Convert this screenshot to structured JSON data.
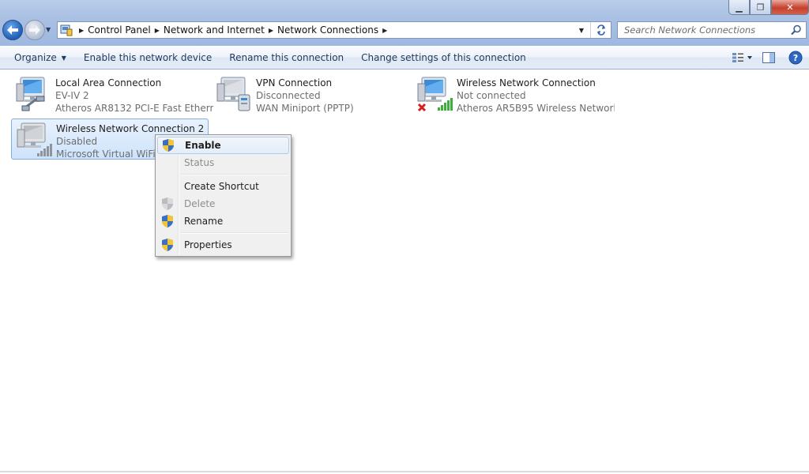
{
  "window": {
    "minimize_label": "▁",
    "maximize_label": "❐",
    "close_label": "✕"
  },
  "address": {
    "crumbs": [
      "Control Panel",
      "Network and Internet",
      "Network Connections"
    ]
  },
  "search": {
    "placeholder": "Search Network Connections"
  },
  "commands": {
    "organize": "Organize",
    "enable": "Enable this network device",
    "rename": "Rename this connection",
    "change": "Change settings of this connection"
  },
  "connections": [
    {
      "name": "Local Area Connection",
      "status": "EV-IV  2",
      "device": "Atheros AR8132 PCI-E Fast Ethern...",
      "icon": "ethernet-adapter-icon"
    },
    {
      "name": "VPN Connection",
      "status": "Disconnected",
      "device": "WAN Miniport (PPTP)",
      "icon": "vpn-icon"
    },
    {
      "name": "Wireless Network Connection",
      "status": "Not connected",
      "device": "Atheros AR5B95 Wireless Network...",
      "icon": "wireless-not-connected-icon"
    },
    {
      "name": "Wireless Network Connection 2",
      "status": "Disabled",
      "device": "Microsoft Virtual WiFi Miniport Adapter",
      "icon": "wireless-disabled-icon"
    }
  ],
  "context_menu": {
    "items": [
      {
        "label": "Enable",
        "bold": true,
        "shield": true,
        "disabled": false
      },
      {
        "label": "Status",
        "bold": false,
        "shield": false,
        "disabled": true
      },
      {
        "label": "Create Shortcut",
        "bold": false,
        "shield": false,
        "disabled": false
      },
      {
        "label": "Delete",
        "bold": false,
        "shield": true,
        "disabled": true
      },
      {
        "label": "Rename",
        "bold": false,
        "shield": true,
        "disabled": false
      },
      {
        "label": "Properties",
        "bold": false,
        "shield": true,
        "disabled": false
      }
    ]
  },
  "colors": {
    "chrome": "#a9c0e3",
    "selection": "#cde3fb",
    "menu_bg": "#f0f0f0",
    "command_text": "#1e395b",
    "muted_text": "#6d6d6d"
  }
}
